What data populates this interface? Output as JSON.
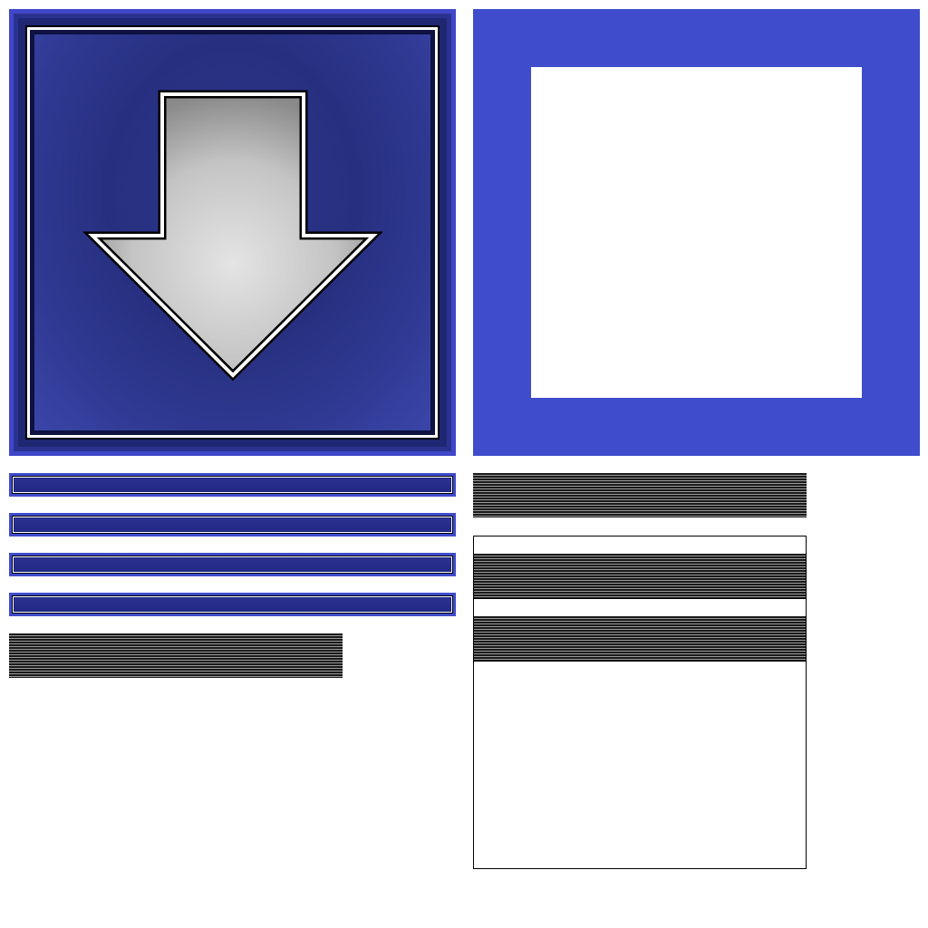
{
  "arrow_button": {
    "icon": "down-arrow-icon",
    "colors": {
      "frame": "#3f47c9",
      "inner": "#273080",
      "arrow": "#c8c8c8"
    }
  },
  "frame_square": {
    "color": "#3f4ccc"
  },
  "bars": [
    {
      "name": "bar-1"
    },
    {
      "name": "bar-2"
    },
    {
      "name": "bar-3"
    },
    {
      "name": "bar-4"
    }
  ],
  "colors": {
    "accent": "#3f4ccc",
    "dark_blue": "#222a86",
    "stripe_dark": "#1a1a1a",
    "stripe_light": "#9a9a9a"
  }
}
